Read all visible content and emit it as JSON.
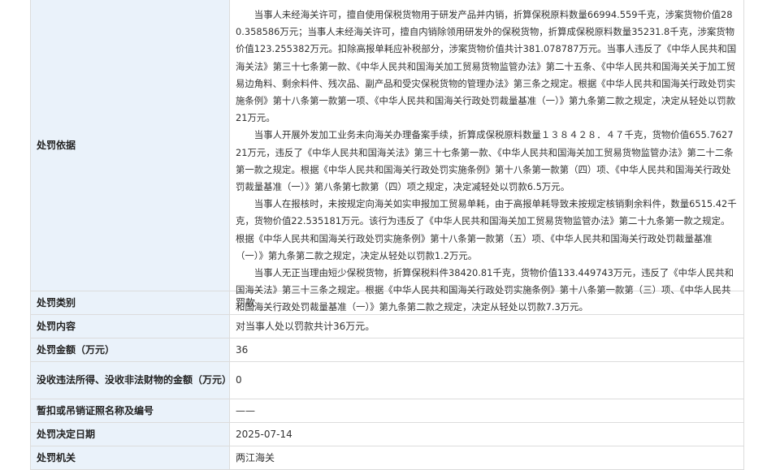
{
  "rows": [
    {
      "label": "处罚依据",
      "paragraphs": [
        "当事人未经海关许可，擅自使用保税货物用于研发产品并内销，折算保税原料数量66994.559千克，涉案货物价值280.358586万元；当事人未经海关许可，擅自内销除领用研发外的保税货物，折算成保税原料数量35231.8千克，涉案货物价值123.255382万元。扣除高报单耗应补税部分，涉案货物价值共计381.078787万元。当事人违反了《中华人民共和国海关法》第三十七条第一款、《中华人民共和国海关加工贸易货物监管办法》第二十五条、《中华人民共和国海关关于加工贸易边角料、剩余料件、残次品、副产品和受灾保税货物的管理办法》第三条之规定。根据《中华人民共和国海关行政处罚实施条例》第十八条第一款第一项、《中华人民共和国海关行政处罚裁量基准（一）》第九条第二款之规定，决定从轻处以罚款21万元。",
        "当事人开展外发加工业务未向海关办理备案手续，折算成保税原料数量１３８４２８．４７千克，货物价值655.762721万元，违反了《中华人民共和国海关法》第三十七条第一款、《中华人民共和国海关加工贸易货物监管办法》第二十二条第一款之规定。根据《中华人民共和国海关行政处罚实施条例》第十八条第一款第（四）项、《中华人民共和国海关行政处罚裁量基准（一）》第八条第七款第（四）项之规定，决定减轻处以罚款6.5万元。",
        "当事人在报核时，未按规定向海关如实申报加工贸易单耗，由于高报单耗导致未按规定核销剩余料件，数量6515.42千克，货物价值22.535181万元。该行为违反了《中华人民共和国海关加工贸易货物监管办法》第二十九条第一款之规定。根据《中华人民共和国海关行政处罚实施条例》第十八条第一款第（五）项、《中华人民共和国海关行政处罚裁量基准（一）》第九条第二款之规定，决定从轻处以罚款1.2万元。",
        "当事人无正当理由短少保税货物，折算保税料件38420.81千克，货物价值133.449743万元，违反了《中华人民共和国海关法》第三十三条之规定。根据《中华人民共和国海关行政处罚实施条例》第十八条第一款第（三）项、《中华人民共和国海关行政处罚裁量基准（一）》第九条第二款之规定，决定从轻处以罚款7.3万元。"
      ]
    },
    {
      "label": "处罚类别",
      "value": "罚款"
    },
    {
      "label": "处罚内容",
      "value": "对当事人处以罚款共计36万元。"
    },
    {
      "label": "处罚金额（万元）",
      "value": "36"
    },
    {
      "label": "没收违法所得、没收非法财物的金额（万元）",
      "value": "0"
    },
    {
      "label": "暂扣或吊销证照名称及编号",
      "value": "——"
    },
    {
      "label": "处罚决定日期",
      "value": "2025-07-14"
    },
    {
      "label": "处罚机关",
      "value": "两江海关"
    }
  ]
}
